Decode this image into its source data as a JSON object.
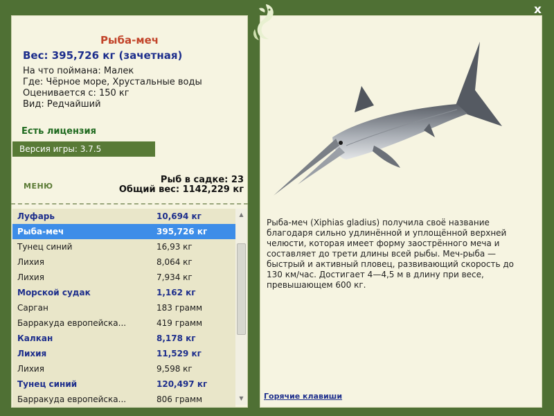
{
  "fish": {
    "name": "Рыба-меч",
    "weight": "Вес: 395,726 кг (зачетная)",
    "caught_on": "На что поймана: Малек",
    "where": "Где: Чёрное море, Хрустальные воды",
    "valued_from": "Оценивается с: 150 кг",
    "kind": "Вид: Редчайший"
  },
  "license": "Есть лицензия",
  "version": "Версия игры: 3.7.5",
  "menu_label": "МЕНЮ",
  "stats": {
    "count": "Рыб в садке: 23",
    "total": "Общий вес: 1142,229 кг"
  },
  "catch_list": [
    {
      "name": "Луфарь",
      "weight": "10,694 кг",
      "style": "bold"
    },
    {
      "name": "Рыба-меч",
      "weight": "395,726 кг",
      "style": "selected"
    },
    {
      "name": "Тунец синий",
      "weight": "16,93 кг",
      "style": "normal"
    },
    {
      "name": "Лихия",
      "weight": "8,064 кг",
      "style": "normal"
    },
    {
      "name": "Лихия",
      "weight": "7,934 кг",
      "style": "normal"
    },
    {
      "name": "Морской судак",
      "weight": "1,162 кг",
      "style": "bold"
    },
    {
      "name": "Сарган",
      "weight": "183 грамм",
      "style": "normal"
    },
    {
      "name": "Барракуда европейска...",
      "weight": "419 грамм",
      "style": "normal"
    },
    {
      "name": "Калкан",
      "weight": "8,178 кг",
      "style": "bold"
    },
    {
      "name": "Лихия",
      "weight": "11,529 кг",
      "style": "bold"
    },
    {
      "name": "Лихия",
      "weight": "9,598 кг",
      "style": "normal"
    },
    {
      "name": "Тунец синий",
      "weight": "120,497 кг",
      "style": "bold"
    },
    {
      "name": "Барракуда европейска...",
      "weight": "806 грамм",
      "style": "normal"
    }
  ],
  "description": "Рыба-меч (Xiphias gladius) получила своё название благодаря сильно удлинённой и уплощённой верхней челюсти, которая имеет форму заострённого меча и составляет до трети длины всей рыбы. Меч-рыба — быстрый и активный пловец, развивающий скорость до 130 км/час. Достигает 4—4,5 м в длину при весе, превышающем 600 кг.",
  "hotkeys_label": "Горячие клавиши",
  "close_label": "x",
  "icons": {
    "logo": "fish-logo-icon",
    "close": "close-icon",
    "scroll_up": "scroll-up-icon",
    "scroll_down": "scroll-down-icon"
  },
  "colors": {
    "background": "#4f7034",
    "panel": "#f6f4e1",
    "fish_name": "#c2442a",
    "highlight_text": "#1d2e8c",
    "license": "#1f6a1f",
    "selection": "#3d8de8"
  }
}
